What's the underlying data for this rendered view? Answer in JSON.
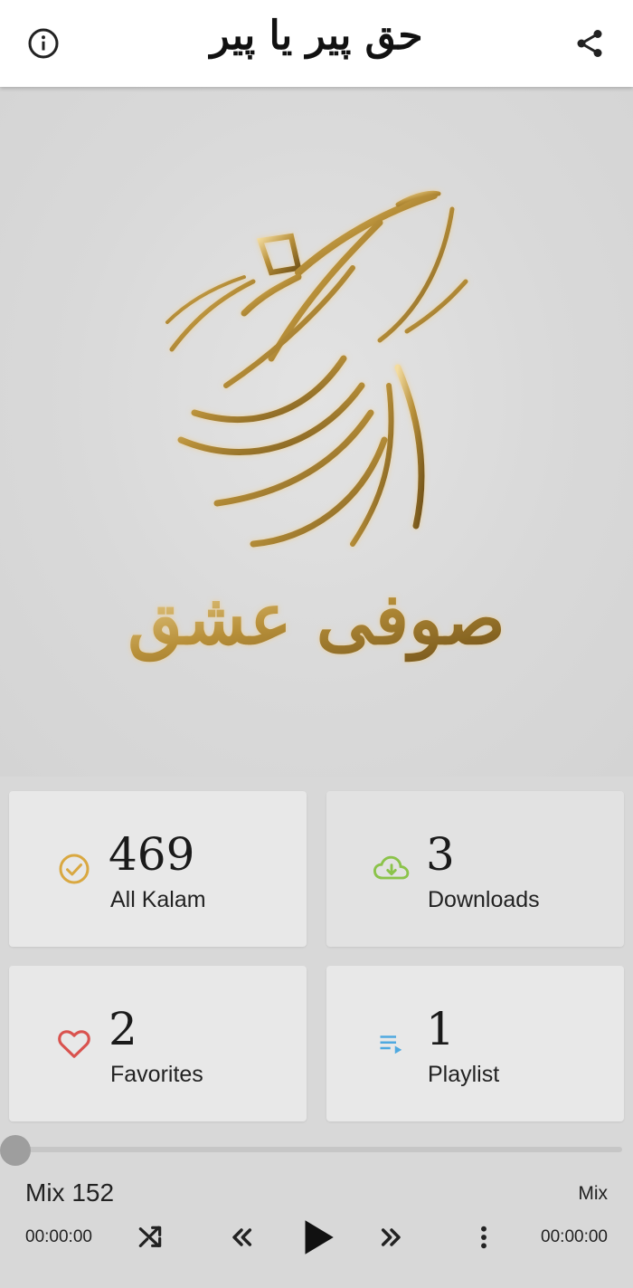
{
  "app": {
    "title": "حق پیر یا پیر",
    "info_icon": "info-icon",
    "share_icon": "share-icon"
  },
  "hero": {
    "calligraphy": "صوفی عشق",
    "accent_color": "#b8903a"
  },
  "stats": [
    {
      "count": "469",
      "label": "All Kalam",
      "icon": "check-circle-icon",
      "color": "#d9a841"
    },
    {
      "count": "3",
      "label": "Downloads",
      "icon": "cloud-download-icon",
      "color": "#8bc34a"
    },
    {
      "count": "2",
      "label": "Favorites",
      "icon": "heart-icon",
      "color": "#d9534f"
    },
    {
      "count": "1",
      "label": "Playlist",
      "icon": "playlist-icon",
      "color": "#4fa9e0"
    }
  ],
  "player": {
    "title": "Mix 152",
    "tag": "Mix",
    "elapsed": "00:00:00",
    "total": "00:00:00",
    "progress": 0
  }
}
